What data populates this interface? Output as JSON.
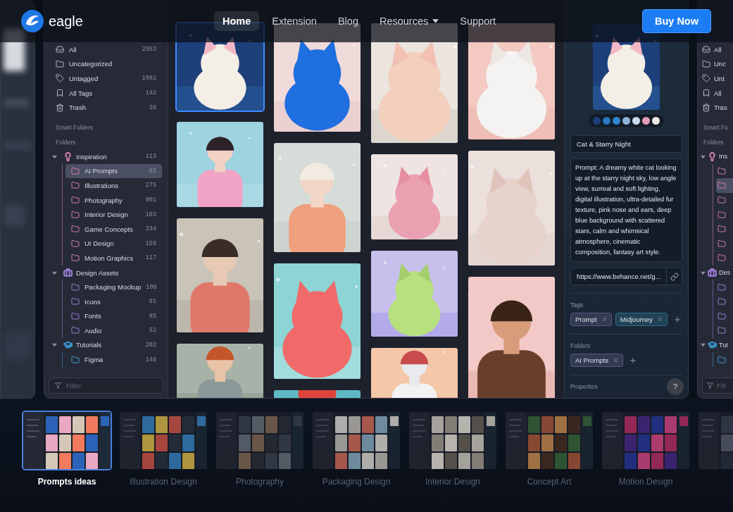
{
  "nav": {
    "logo": "eagle",
    "links": [
      {
        "label": "Home",
        "selected": true,
        "menu": false
      },
      {
        "label": "Extension",
        "selected": false,
        "menu": false
      },
      {
        "label": "Blog",
        "selected": false,
        "menu": false
      },
      {
        "label": "Resources",
        "selected": false,
        "menu": true
      },
      {
        "label": "Support",
        "selected": false,
        "menu": false
      }
    ],
    "cta": "Buy Now"
  },
  "sidebar": {
    "items": [
      {
        "kind": "all",
        "label": "All",
        "count": "2553"
      },
      {
        "kind": "uncategorized",
        "label": "Uncategorized"
      },
      {
        "kind": "untagged",
        "label": "Untagged",
        "count": "1082"
      },
      {
        "kind": "tags",
        "label": "All Tags",
        "count": "142"
      },
      {
        "kind": "trash",
        "label": "Trash",
        "count": "36"
      }
    ],
    "headings": [
      "Smart Folders",
      "Folders"
    ],
    "groups": [
      {
        "kind": "idea",
        "label": "Inspiration",
        "count": "113",
        "color": "#d77fb0",
        "expanded": true,
        "children": [
          {
            "label": "AI Prompts",
            "count": "65",
            "selected": true
          },
          {
            "label": "Illustrations",
            "count": "275",
            "selected": false
          },
          {
            "label": "Photography",
            "count": "801",
            "selected": false
          },
          {
            "label": "Interior Design",
            "count": "103",
            "selected": false
          },
          {
            "label": "Game Concepts",
            "count": "234",
            "selected": false
          },
          {
            "label": "UI Design",
            "count": "159",
            "selected": false
          },
          {
            "label": "Motion Graphics",
            "count": "117",
            "selected": false
          }
        ]
      },
      {
        "kind": "assets",
        "label": "Design Assets",
        "color": "#9c80d8",
        "expanded": true,
        "children": [
          {
            "label": "Packaging Mockup",
            "count": "108",
            "selected": false
          },
          {
            "label": "Icons",
            "count": "91",
            "selected": false
          },
          {
            "label": "Fonts",
            "count": "85",
            "selected": false
          },
          {
            "label": "Audio",
            "count": "52",
            "selected": false
          }
        ]
      },
      {
        "kind": "course",
        "label": "Tutorials",
        "count": "202",
        "color": "#3b9ad8",
        "expanded": true,
        "children": [
          {
            "label": "Figma",
            "count": "148",
            "selected": false
          }
        ]
      }
    ],
    "filter": {
      "placeholder": "Filter"
    }
  },
  "grid": {
    "items": [
      {
        "kind": "picture",
        "selected": true
      },
      {
        "kind": "picture",
        "selected": false
      },
      {
        "kind": "picture",
        "selected": false
      },
      {
        "kind": "picture",
        "selected": false
      },
      {
        "kind": "picture",
        "selected": false
      },
      {
        "kind": "picture",
        "selected": false
      },
      {
        "kind": "picture",
        "selected": false
      },
      {
        "kind": "picture",
        "selected": false
      },
      {
        "kind": "picture",
        "selected": false
      },
      {
        "kind": "picture",
        "selected": false
      },
      {
        "kind": "picture",
        "selected": false
      },
      {
        "kind": "picture",
        "selected": false
      },
      {
        "kind": "picture",
        "selected": false
      },
      {
        "kind": "picture",
        "selected": false
      },
      {
        "kind": "picture",
        "selected": false
      }
    ]
  },
  "inspector": {
    "preview": {
      "kind": "picture"
    },
    "palette": [
      {
        "color": "#1c3f7a"
      },
      {
        "color": "#2a78c0"
      },
      {
        "color": "#2f86d2"
      },
      {
        "color": "#8fb3d6"
      },
      {
        "color": "#c9dbef"
      },
      {
        "color": "#e39ab5"
      },
      {
        "color": "#ece8e2"
      }
    ],
    "title": "Cat & Starry Night",
    "notes": "Prompt: A dreamy white cat looking up at the starry night sky, low angle view, surreal and soft lighting, digital illustration, ultra-detailed fur texture, pink nose and ears, deep blue background with scattered stars, calm and whimsical atmosphere, cinematic composition, fantasy art style.",
    "url": "https://www.behance.net/g...",
    "sections": [
      {
        "heading": "Tags",
        "chips": [
          {
            "label": "Prompt",
            "color": "#55597e"
          },
          {
            "label": "Midjourney",
            "color": "#2a6d88"
          }
        ]
      },
      {
        "heading": "Folders",
        "chips": [
          {
            "label": "AI Prompts",
            "color": "#55597e"
          }
        ]
      },
      {
        "heading": "Properties"
      }
    ],
    "help": "?"
  },
  "right_window": {
    "items": [
      {
        "kind": "all",
        "label": "All"
      },
      {
        "kind": "uncategorized",
        "label": "Unc"
      },
      {
        "kind": "untagged",
        "label": "Unt"
      },
      {
        "kind": "tags",
        "label": "All"
      },
      {
        "kind": "trash",
        "label": "Tras"
      }
    ],
    "headings": [
      "Smart Fo",
      "Folders"
    ],
    "groups": [
      {
        "kind": "idea",
        "label": "Ins",
        "color": "#d77fb0",
        "expanded": true,
        "children": [
          {
            "selected": false
          },
          {
            "selected": true
          },
          {
            "selected": false
          },
          {
            "selected": false
          },
          {
            "selected": false
          },
          {
            "selected": false
          },
          {
            "selected": false
          }
        ]
      },
      {
        "kind": "assets",
        "label": "Des",
        "color": "#9c80d8",
        "expanded": true,
        "children": [
          {
            "selected": false
          },
          {
            "selected": false
          },
          {
            "selected": false
          },
          {
            "selected": false
          }
        ]
      },
      {
        "kind": "course",
        "label": "Tut",
        "color": "#3b9ad8",
        "expanded": true,
        "children": [
          {
            "selected": false
          }
        ]
      }
    ],
    "filter": {
      "placeholder": "Filt"
    }
  },
  "showcases": [
    {
      "label": "Prompts ideas",
      "selected": true
    },
    {
      "label": "Illustration Design",
      "selected": false
    },
    {
      "label": "Photography",
      "selected": false
    },
    {
      "label": "Packaging Design",
      "selected": false
    },
    {
      "label": "Interior Design",
      "selected": false
    },
    {
      "label": "Concept Art",
      "selected": false
    },
    {
      "label": "Motion Design",
      "selected": false
    },
    {
      "selected": false
    }
  ]
}
